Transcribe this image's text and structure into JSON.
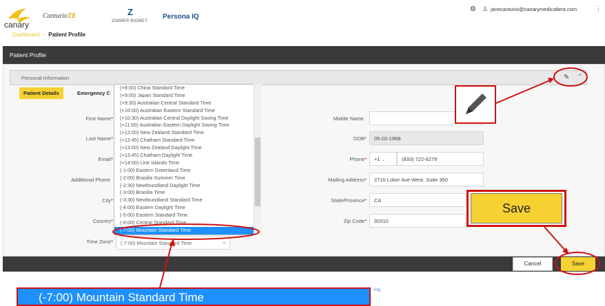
{
  "header": {
    "canary_logo_text": "canary",
    "canturio_te": "Canturio",
    "canturio_te_suffix": "TE",
    "zimmer_biomet": "ZIMMER BIOMET",
    "zimmer_mark": "Z",
    "persona_iq": "Persona IQ",
    "user_email": "janecanturio@canarymedicaltest.com",
    "gear_icon": "⚙",
    "user_icon": "♙",
    "kebab_icon": "⋮",
    "breadcrumb": {
      "link": "Dashboard",
      "separator": "-",
      "current": "Patient Profile"
    }
  },
  "title_bar": {
    "title": "Patient Profile"
  },
  "section": {
    "title": "Personal Information",
    "tabs": [
      {
        "label": "Patient Details",
        "active": true
      },
      {
        "label": "Emergency C",
        "active": false
      }
    ]
  },
  "form": {
    "left": [
      {
        "label": "First Name",
        "required": true
      },
      {
        "label": "Last Name",
        "required": true
      },
      {
        "label": "Email",
        "required": true
      },
      {
        "label": "Additional Phone",
        "required": false
      },
      {
        "label": "City",
        "required": true
      },
      {
        "label": "Country",
        "required": true
      },
      {
        "label": "Time Zone",
        "required": true
      }
    ],
    "right": [
      {
        "label": "Middle Name",
        "required": false,
        "value": ""
      },
      {
        "label": "DOB",
        "required": true,
        "value": "05-02-1968"
      },
      {
        "label": "Phone",
        "required": true,
        "country_code": "+1",
        "value": "(833) 722-6279"
      },
      {
        "label": "Mailing Address",
        "required": true,
        "value": "2710 Loker Ave West, Suite 350"
      },
      {
        "label": "State/Province",
        "required": true,
        "value": "CA"
      },
      {
        "label": "Zip Code",
        "required": true,
        "value": "92010"
      }
    ],
    "time_zone_value": "(-7:00) Mountain Standard Time"
  },
  "timezone_options": [
    "(+8:00) China Standard Time",
    "(+9:00) Japan Standard Time",
    "(+9:30) Australian Central Standard Time",
    "(+10:00) Australian Eastern Standard Time",
    "(+10:30) Australian Central Daylight Saving Time",
    "(+11:00) Australian Eastern Daylight Saving Time",
    "(+12:00) New Zealand Standard Time",
    "(+12:45) Chatham Standard Time",
    "(+13:00) New Zealand Daylight Time",
    "(+13:45) Chatham Daylight Time",
    "(+14:00) Line Islands Time",
    "(-1:00) Eastern Greenland Time",
    "(-2:00) Brasilia Summer Time",
    "(-2:30) Newfoundland Daylight Time",
    "(-3:00) Brasilia Time",
    "(-3:30) Newfoundland Standard Time",
    "(-4:00) Eastern Daylight Time",
    "(-5:00) Eastern Standard Time",
    "(-6:00) Central Standard Time",
    "(-7:00) Mountain Standard Time"
  ],
  "selected_timezone_index": 19,
  "buttons": {
    "cancel": "Cancel",
    "save": "Save"
  },
  "callouts": {
    "save_label": "Save",
    "timezone_label": "(-7:00) Mountain Standard Time",
    "tiny_link": "ring"
  },
  "colors": {
    "accent_yellow": "#f5d232",
    "annotation_red": "#d01010",
    "selection_blue": "#1e90ff",
    "dark_bar": "#3a3a3a"
  }
}
